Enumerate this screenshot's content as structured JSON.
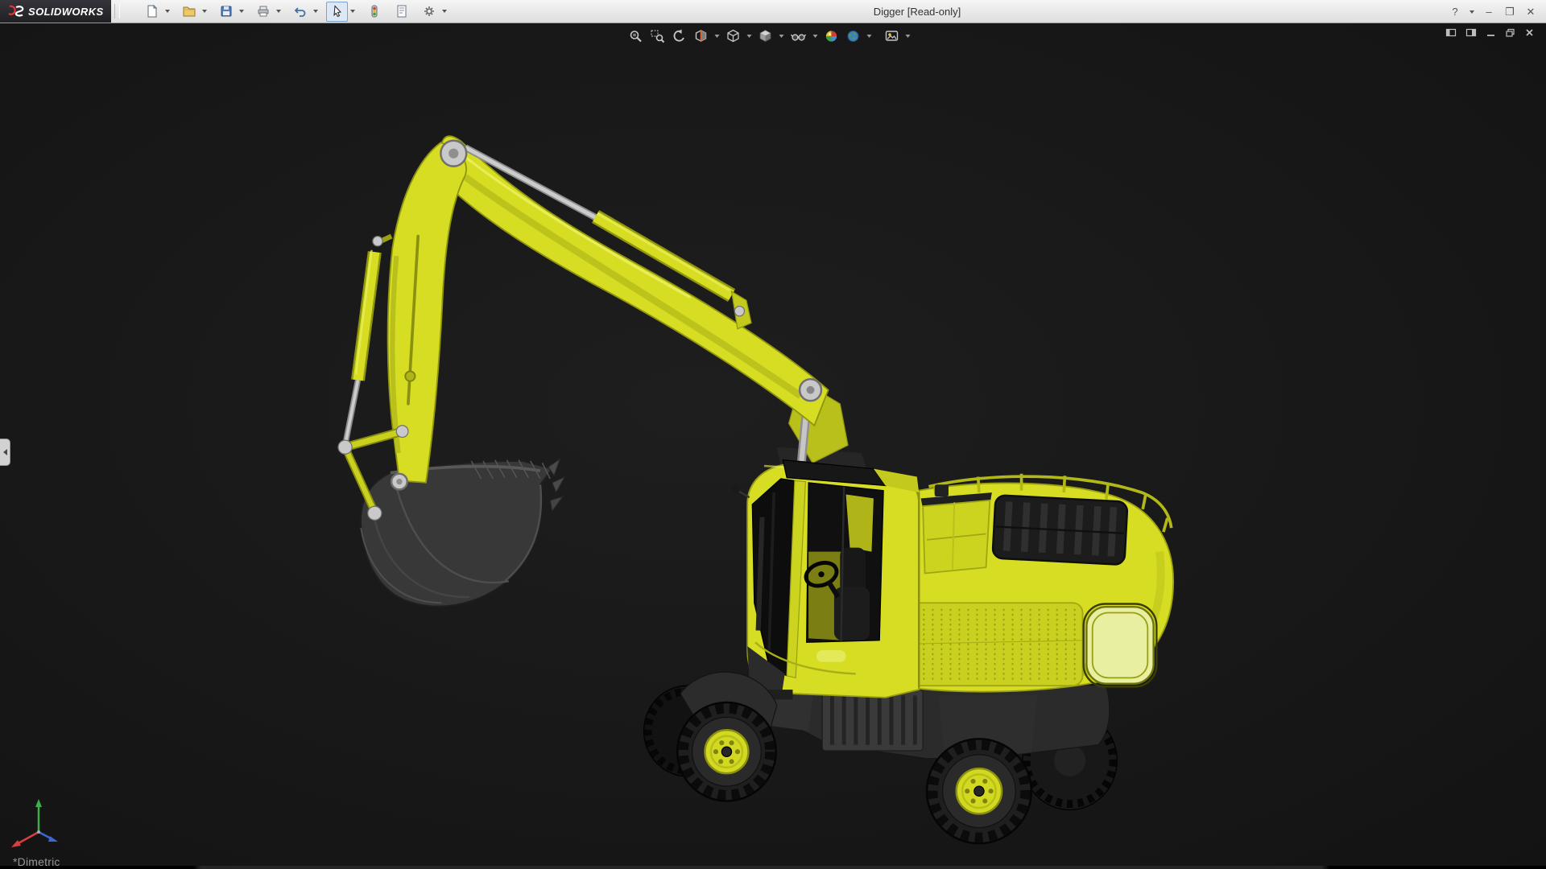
{
  "titlebar": {
    "brand": "SOLIDWORKS",
    "title": "Digger [Read-only]",
    "help_glyph": "?",
    "minimize_glyph": "–",
    "maximize_glyph": "❐",
    "close_glyph": "✕"
  },
  "main_toolbar": {
    "items": [
      {
        "id": "new-document",
        "dropdown": true
      },
      {
        "id": "open",
        "dropdown": true
      },
      {
        "id": "save",
        "dropdown": true
      },
      {
        "id": "print",
        "dropdown": true
      },
      {
        "id": "undo",
        "dropdown": true
      },
      {
        "id": "select",
        "dropdown": true,
        "pressed": true
      },
      {
        "id": "rebuild",
        "dropdown": false
      },
      {
        "id": "file-properties",
        "dropdown": false
      },
      {
        "id": "options",
        "dropdown": true
      }
    ]
  },
  "view_toolbar": {
    "items": [
      {
        "id": "zoom-to-fit"
      },
      {
        "id": "zoom-to-area"
      },
      {
        "id": "previous-view"
      },
      {
        "id": "section-view",
        "dropdown": true
      },
      {
        "id": "view-orientation",
        "dropdown": true
      },
      {
        "id": "display-style",
        "dropdown": true
      },
      {
        "id": "hide-show-items",
        "dropdown": true
      },
      {
        "id": "edit-appearance"
      },
      {
        "id": "apply-scene",
        "dropdown": true
      },
      {
        "id": "view-settings",
        "dropdown": true
      }
    ]
  },
  "document_controls": {
    "items": [
      {
        "id": "pane-left"
      },
      {
        "id": "pane-right"
      },
      {
        "id": "minimize"
      },
      {
        "id": "restore"
      },
      {
        "id": "close"
      }
    ]
  },
  "viewport": {
    "orientation_label": "*Dimetric",
    "background": "#161616",
    "model_name": "Digger",
    "colors": {
      "body_yellow": "#d6dd22",
      "shadow_yellow": "#9aa012",
      "dark_gray": "#2e2e2e",
      "metal": "#c6c6c6",
      "triad_x": "#d54040",
      "triad_y": "#3fae49",
      "triad_z": "#3a66d6"
    }
  }
}
